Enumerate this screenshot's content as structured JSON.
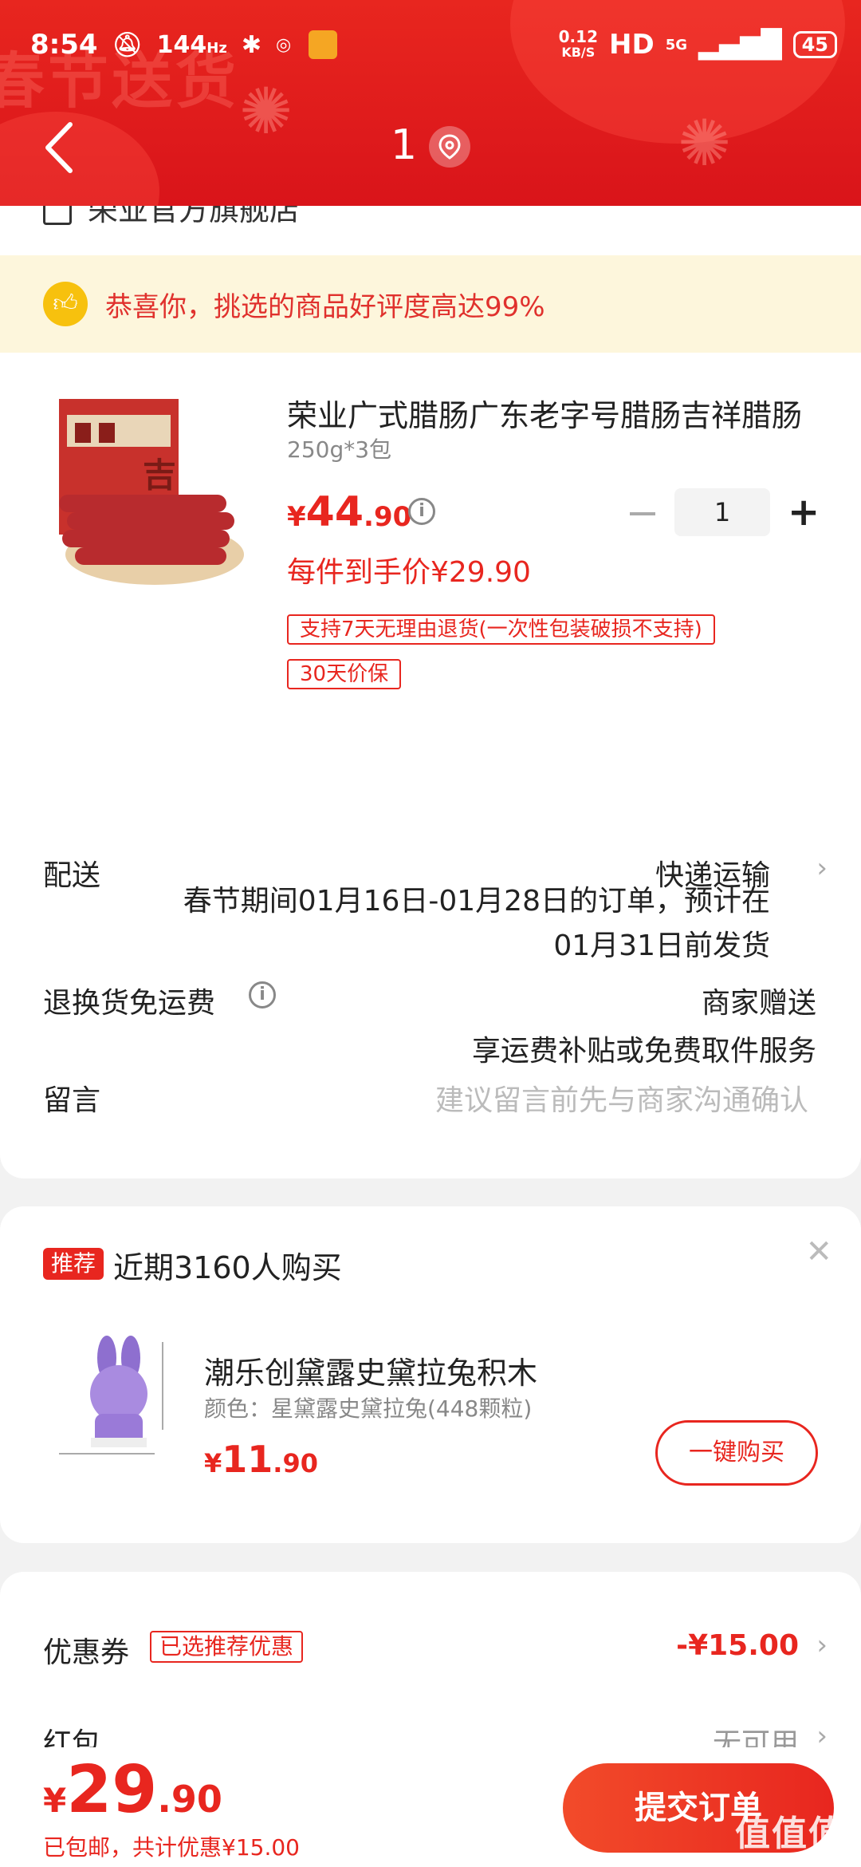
{
  "status": {
    "time": "8:54",
    "refresh": "144",
    "refresh_unit": "Hz",
    "net_speed": "0.12",
    "net_unit": "KB/S",
    "hd": "HD",
    "signal": "5G",
    "battery": "45"
  },
  "header": {
    "deco_text": "春节送货",
    "count": "1",
    "colors": {
      "primary": "#e8261f",
      "banner_bg": "#fdf6dc"
    }
  },
  "store": {
    "name": "荣业官方旗舰店"
  },
  "banner": {
    "text": "恭喜你，挑选的商品好评度高达99%"
  },
  "product": {
    "title": "荣业广式腊肠广东老字号腊肠吉祥腊肠",
    "spec": "250g*3包",
    "price_symbol": "¥",
    "price_int": "44",
    "price_dec": ".90",
    "quantity": "1",
    "each_price_label": "每件到手价¥29.90",
    "tags": [
      "支持7天无理由退货(一次性包装破损不支持)",
      "30天价保"
    ]
  },
  "delivery": {
    "label": "配送",
    "method": "快递运输",
    "note": "春节期间01月16日-01月28日的订单，预计在01月31日前发货"
  },
  "return_shipping": {
    "label": "退换货免运费",
    "value": "商家赠送",
    "sub": "享运费补贴或免费取件服务"
  },
  "message": {
    "label": "留言",
    "placeholder": "建议留言前先与商家沟通确认"
  },
  "recommend": {
    "badge": "推荐",
    "title": "近期3160人购买",
    "item_name": "潮乐创黛露史黛拉兔积木",
    "item_spec": "颜色：星黛露史黛拉兔(448颗粒)",
    "price_symbol": "¥",
    "price_int": "11",
    "price_dec": ".90",
    "buy_label": "一键购买"
  },
  "coupon": {
    "label": "优惠券",
    "tag": "已选推荐优惠",
    "value": "-¥15.00"
  },
  "hongbao": {
    "label": "红包",
    "value": "无可用"
  },
  "bottom": {
    "price_symbol": "¥",
    "price_int": "29",
    "price_dec": ".90",
    "saved": "已包邮，共计优惠¥15.00",
    "submit_label": "提交订单",
    "watermark": "值值值",
    "watermark_url": "zhizhizhi.com"
  }
}
